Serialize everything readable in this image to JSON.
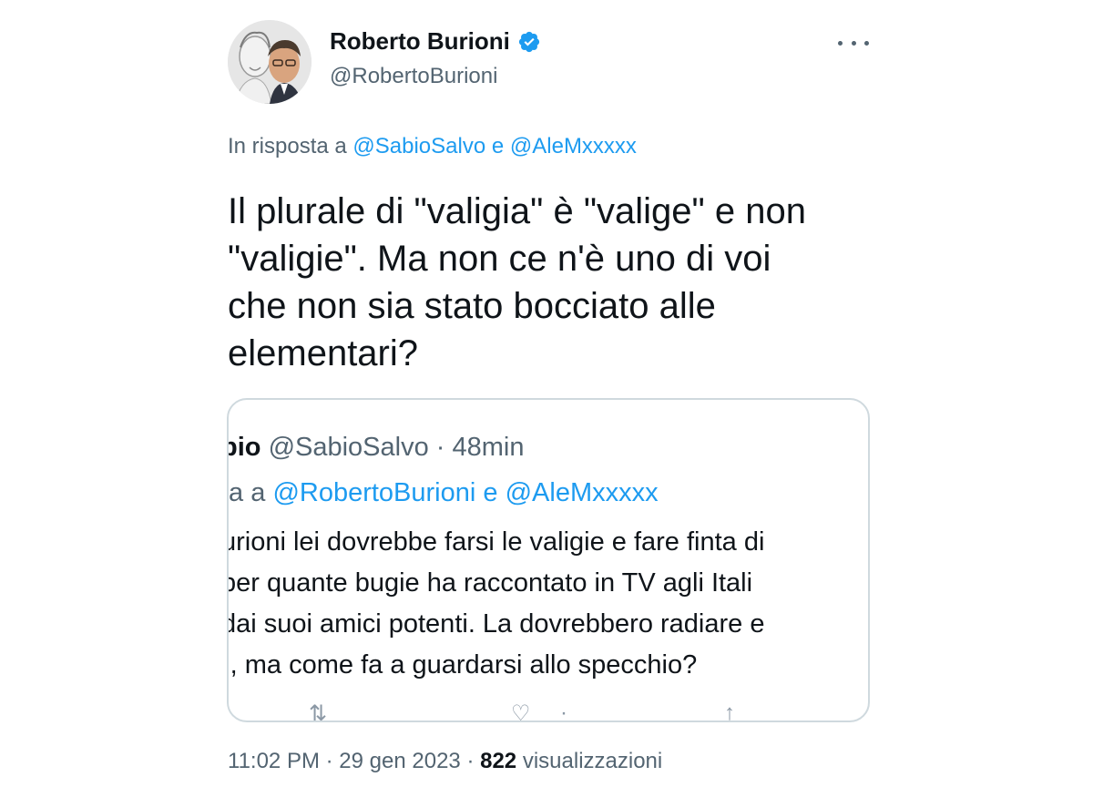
{
  "author": {
    "display_name": "Roberto Burioni",
    "handle": "@RobertoBurioni",
    "verified": true
  },
  "reply_context": {
    "prefix": "In risposta a",
    "mention1": "@SabioSalvo",
    "conjunction": "e",
    "mention2": "@AleMxxxxx"
  },
  "tweet": {
    "lines": [
      "Il plurale di \"valigia\" è \"valige\" e non",
      "\"valigie\". Ma non ce n'è uno di voi",
      "che non sia stato bocciato alle",
      "elementari?"
    ]
  },
  "quoted_tweet": {
    "name_fragment": "bio",
    "handle": "@SabioSalvo",
    "separator": "·",
    "time": "48min",
    "reply_prefix_fragment": "ta a",
    "reply_mention1": "@RobertoBurioni",
    "reply_conjunction": "e",
    "reply_mention2": "@AleMxxxxx",
    "body_lines": [
      "urioni lei dovrebbe farsi le valigie e fare finta di",
      " per quante bugie ha raccontato in TV agli Itali",
      "dai suoi amici potenti. La dovrebbero radiare e",
      "·, ma come fa a guardarsi allo specchio?"
    ]
  },
  "meta": {
    "time": "11:02 PM",
    "date": "29 gen 2023",
    "separator": "·",
    "views_count": "822",
    "views_label": "visualizzazioni"
  },
  "colors": {
    "link": "#1d9bf0",
    "secondary_text": "#536471",
    "primary_text": "#0f1419",
    "border": "#cfd9de",
    "verified": "#1d9bf0"
  }
}
